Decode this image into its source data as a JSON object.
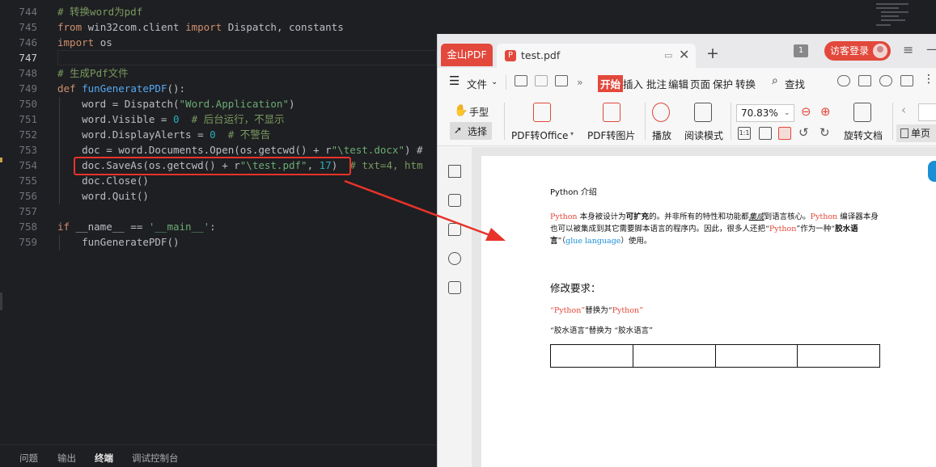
{
  "editor": {
    "lines": [
      {
        "num": "744",
        "tokens": [
          {
            "t": "# 转换word为pdf",
            "c": "cmt"
          }
        ]
      },
      {
        "num": "745",
        "tokens": [
          {
            "t": "from ",
            "c": "kw"
          },
          {
            "t": "win32com.client ",
            "c": "plain"
          },
          {
            "t": "import ",
            "c": "kw"
          },
          {
            "t": "Dispatch, constants",
            "c": "plain"
          }
        ]
      },
      {
        "num": "746",
        "tokens": [
          {
            "t": "import ",
            "c": "kw"
          },
          {
            "t": "os",
            "c": "plain"
          }
        ]
      },
      {
        "num": "747",
        "tokens": []
      },
      {
        "num": "748",
        "tokens": [
          {
            "t": "# 生成Pdf文件",
            "c": "cmt"
          }
        ]
      },
      {
        "num": "749",
        "tokens": [
          {
            "t": "def ",
            "c": "kw"
          },
          {
            "t": "funGeneratePDF",
            "c": "fn"
          },
          {
            "t": "():",
            "c": "plain"
          }
        ]
      },
      {
        "num": "750",
        "tokens": [
          {
            "t": "    word = Dispatch(",
            "c": "plain"
          },
          {
            "t": "\"Word.Application\"",
            "c": "str"
          },
          {
            "t": ")",
            "c": "plain"
          }
        ]
      },
      {
        "num": "751",
        "tokens": [
          {
            "t": "    word.Visible = ",
            "c": "plain"
          },
          {
            "t": "0",
            "c": "num"
          },
          {
            "t": "  # 后台运行，不显示",
            "c": "cmt"
          }
        ]
      },
      {
        "num": "752",
        "tokens": [
          {
            "t": "    word.DisplayAlerts = ",
            "c": "plain"
          },
          {
            "t": "0",
            "c": "num"
          },
          {
            "t": "  # 不警告",
            "c": "cmt"
          }
        ]
      },
      {
        "num": "753",
        "tokens": [
          {
            "t": "    doc = word.Documents.Open(os.getcwd() + r",
            "c": "plain"
          },
          {
            "t": "\"\\test.docx\"",
            "c": "str"
          },
          {
            "t": ") #",
            "c": "plain"
          }
        ]
      },
      {
        "num": "754",
        "tokens": [
          {
            "t": "    doc.SaveAs(os.getcwd() + r",
            "c": "plain"
          },
          {
            "t": "\"\\test.pdf\"",
            "c": "str"
          },
          {
            "t": ", ",
            "c": "plain"
          },
          {
            "t": "17",
            "c": "num"
          },
          {
            "t": ")",
            "c": "plain"
          },
          {
            "t": "  # txt=4, htm",
            "c": "cmt"
          }
        ]
      },
      {
        "num": "755",
        "tokens": [
          {
            "t": "    doc.Close()",
            "c": "plain"
          }
        ]
      },
      {
        "num": "756",
        "tokens": [
          {
            "t": "    word.Quit()",
            "c": "plain"
          }
        ]
      },
      {
        "num": "757",
        "tokens": []
      },
      {
        "num": "758",
        "tokens": [
          {
            "t": "if ",
            "c": "kw"
          },
          {
            "t": "__name__ == ",
            "c": "plain"
          },
          {
            "t": "'__main__'",
            "c": "str"
          },
          {
            "t": ":",
            "c": "plain"
          }
        ]
      },
      {
        "num": "759",
        "tokens": [
          {
            "t": "    funGeneratePDF()",
            "c": "plain"
          }
        ]
      }
    ],
    "current_line": "747",
    "bottom_tabs": [
      "问题",
      "输出",
      "终端",
      "调试控制台"
    ],
    "active_bottom_tab": "终端"
  },
  "pdf_app": {
    "app_tab": "金山PDF",
    "doc_tab": "test.pdf",
    "doc_icon": "P",
    "window_count": "1",
    "login": "访客登录",
    "menu": {
      "file": "文件",
      "more": "»",
      "start": "开始",
      "insert": "插入",
      "annotate": "批注",
      "edit": "编辑",
      "page": "页面",
      "protect": "保护",
      "convert": "转换",
      "search": "查找"
    },
    "tools": {
      "hand": "手型",
      "select": "选择",
      "to_office": "PDF转Office",
      "to_image": "PDF转图片",
      "play": "播放",
      "read_mode": "阅读模式",
      "zoom": "70.83%",
      "rotate": "旋转文档",
      "single_page": "单页",
      "one_to_one": "1:1"
    }
  },
  "pdf_page": {
    "title": "Python 介绍",
    "para": {
      "s1": "Python",
      "s2": " 本身被设计为",
      "s3": "可扩充",
      "s4": "的。并非所有的特性和功能都",
      "s5": "集成",
      "s6": "到语言核心。",
      "s7": "Python",
      "s8": " 编译器本身也可以被集成到其它需要脚本语言的程序内。因此，很多人还把“",
      "s9": "Python",
      "s10": "”作为一种“",
      "s11": "胶水语言",
      "s12": "”（",
      "s13": "glue language",
      "s14": "）使用。"
    },
    "requirements_title": "修改要求：",
    "r1a": "“Python”",
    "r1b": "替换为“",
    "r1c": "Python",
    "r1d": "”",
    "r2": "“胶水语言”替换为 “胶水语言”"
  },
  "colors": {
    "highlight_red": "#e8332a",
    "wps_red": "#e2483b",
    "link_blue": "#1a8fd6"
  }
}
